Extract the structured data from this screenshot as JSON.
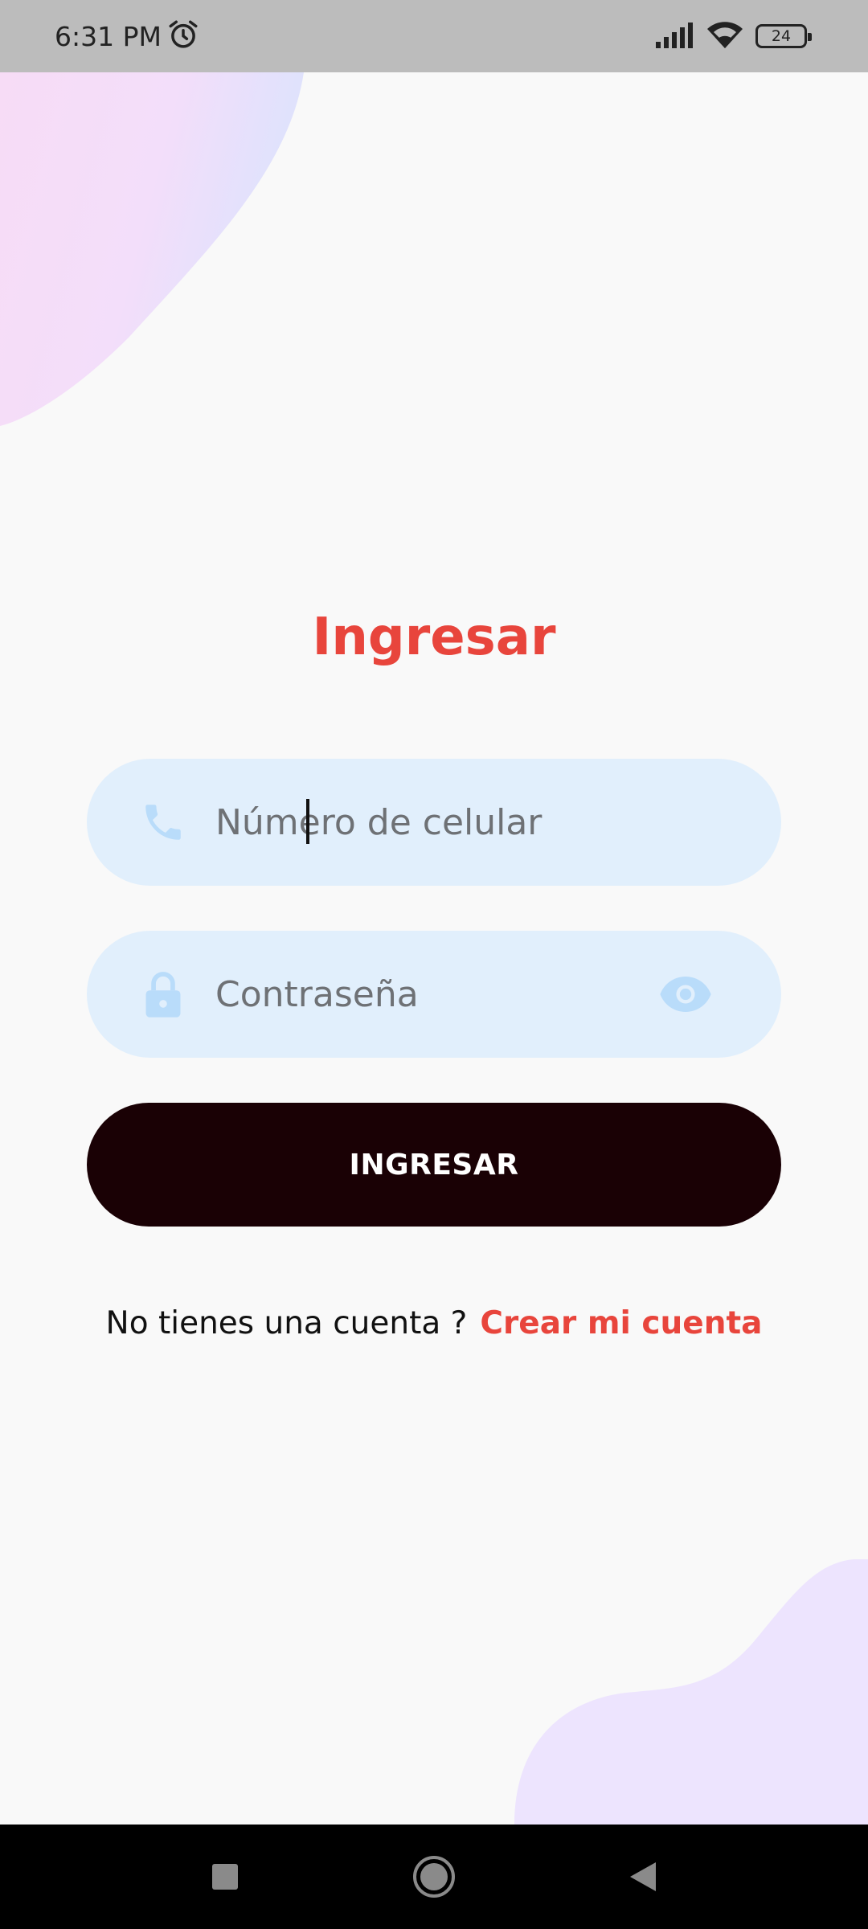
{
  "status_bar": {
    "time": "6:31 PM",
    "battery": "24",
    "icons": [
      "alarm-icon",
      "signal-icon",
      "wifi-icon",
      "battery-icon"
    ]
  },
  "login": {
    "title": "Ingresar",
    "phone_placeholder": "Número de celular",
    "password_placeholder": "Contraseña",
    "button_label": "INGRESAR",
    "no_account_text": "No tienes una cuenta ?",
    "create_account_link": "Crear mi cuenta"
  },
  "nav": [
    "recents-square-icon",
    "home-circle-icon",
    "back-triangle-icon"
  ],
  "colors": {
    "accent": "#e8453c",
    "button": "#1a0105",
    "field_bg": "#e1effc",
    "field_icon": "#b9dcfa",
    "background": "#f9f9f9"
  }
}
